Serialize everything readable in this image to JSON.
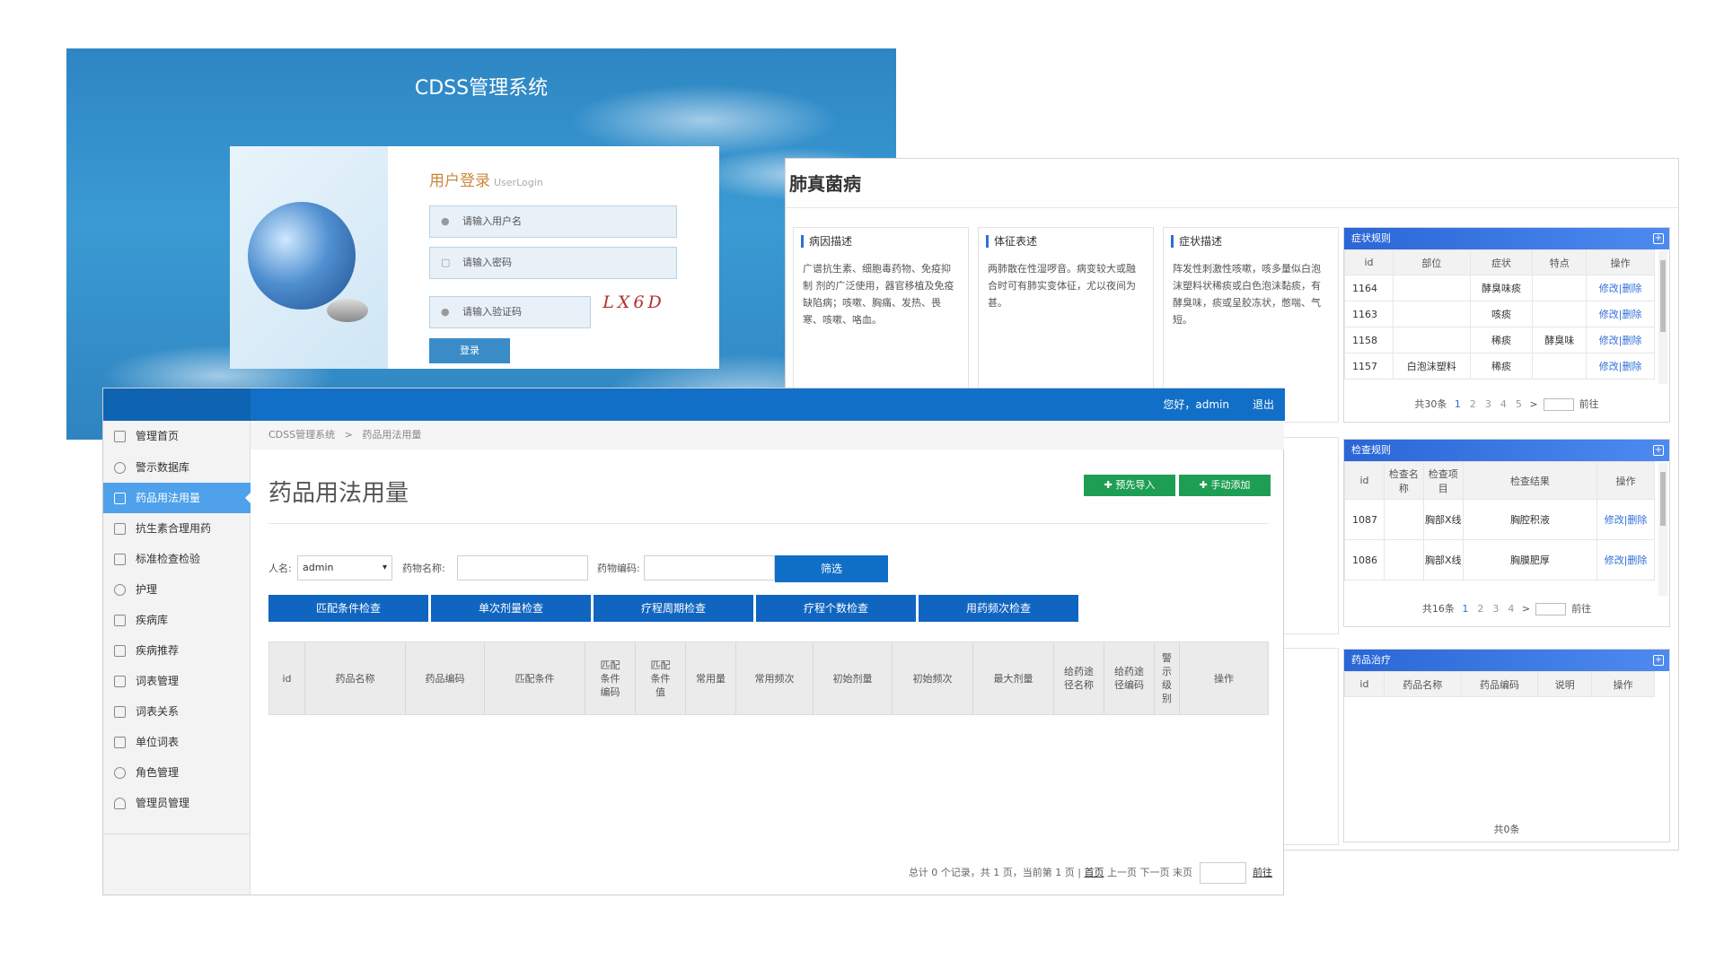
{
  "login": {
    "title": "CDSS管理系统",
    "heading": "用户登录",
    "heading_sub": "UserLogin",
    "username_placeholder": "请输入用户名",
    "password_placeholder": "请输入密码",
    "captcha_placeholder": "请输入验证码",
    "captcha_text": "LX6D",
    "login_button": "登录"
  },
  "detail": {
    "title": "肺真菌病",
    "cards": [
      {
        "label": "病因描述",
        "text": "广谱抗生素、细胞毒药物、免疫抑制 剂的广泛使用，器官移植及免疫缺陷病；咳嗽、胸痛、发热、畏寒、咳嗽、咯血。"
      },
      {
        "label": "体征表述",
        "text": "两肺散在性湿啰音。病变较大或融合时可有肺实变体征，尤以夜间为甚。"
      },
      {
        "label": "症状描述",
        "text": "阵发性刺激性咳嗽，咳多量似白泡沫塑料状稀痰或白色泡沫黏痰，有酵臭味，痰或呈胶冻状，憋喘、气短。"
      }
    ],
    "symptom_panel": {
      "title": "症状规则",
      "columns": [
        "id",
        "部位",
        "症状",
        "特点",
        "操作"
      ],
      "rows": [
        {
          "id": "1164",
          "part": "",
          "symptom": "酵臭味痰",
          "feature": "",
          "op": "修改|删除"
        },
        {
          "id": "1163",
          "part": "",
          "symptom": "咳痰",
          "feature": "",
          "op": "修改|删除"
        },
        {
          "id": "1158",
          "part": "",
          "symptom": "稀痰",
          "feature": "酵臭味",
          "op": "修改|删除"
        },
        {
          "id": "1157",
          "part": "白泡沫塑料",
          "symptom": "稀痰",
          "feature": "",
          "op": "修改|删除"
        }
      ],
      "total": "共30条",
      "pages": [
        "1",
        "2",
        "3",
        "4",
        "5"
      ],
      "next": ">",
      "goto": "前往"
    },
    "exam_panel": {
      "title": "检查规则",
      "columns": [
        "id",
        "检查名称",
        "检查项目",
        "检查结果",
        "操作"
      ],
      "rows": [
        {
          "id": "1087",
          "name": "",
          "item": "胸部X线",
          "result": "胸腔积液",
          "op": "修改|删除"
        },
        {
          "id": "1086",
          "name": "",
          "item": "胸部X线",
          "result": "胸膜肥厚",
          "op": "修改|删除"
        }
      ],
      "total": "共16条",
      "pages": [
        "1",
        "2",
        "3",
        "4"
      ],
      "next": ">",
      "goto": "前往"
    },
    "drug_panel": {
      "title": "药品治疗",
      "columns": [
        "id",
        "药品名称",
        "药品编码",
        "说明",
        "操作"
      ],
      "total": "共0条"
    }
  },
  "admin": {
    "greeting": "您好，admin",
    "logout": "退出",
    "nav": [
      {
        "label": "管理首页",
        "icon": "home-icon"
      },
      {
        "label": "警示数据库",
        "icon": "refresh-icon"
      },
      {
        "label": "药品用法用量",
        "icon": "file-icon"
      },
      {
        "label": "抗生素合理用药",
        "icon": "book-icon"
      },
      {
        "label": "标准检查检验",
        "icon": "edit-icon"
      },
      {
        "label": "护理",
        "icon": "share-icon"
      },
      {
        "label": "疾病库",
        "icon": "bookmark-icon"
      },
      {
        "label": "疾病推荐",
        "icon": "bookmark-icon"
      },
      {
        "label": "词表管理",
        "icon": "list-icon"
      },
      {
        "label": "词表关系",
        "icon": "list-icon"
      },
      {
        "label": "单位词表",
        "icon": "grid-icon"
      },
      {
        "label": "角色管理",
        "icon": "gear-icon"
      },
      {
        "label": "管理员管理",
        "icon": "user-icon"
      }
    ],
    "breadcrumb": {
      "root": "CDSS管理系统",
      "sep": ">",
      "current": "药品用法用量"
    },
    "page_title": "药品用法用量",
    "import_button": "✚ 预先导入",
    "add_button": "✚ 手动添加",
    "filters": {
      "person_label": "人名:",
      "person_value": "admin",
      "drug_name_label": "药物名称:",
      "drug_code_label": "药物编码:",
      "filter_button": "筛选"
    },
    "check_buttons": [
      "匹配条件检查",
      "单次剂量检查",
      "疗程周期检查",
      "疗程个数检查",
      "用药频次检查"
    ],
    "columns": [
      "id",
      "药品名称",
      "药品编码",
      "匹配条件",
      "匹配条件编码",
      "匹配条件值",
      "常用量",
      "常用频次",
      "初始剂量",
      "初始频次",
      "最大剂量",
      "给药途径名称",
      "给药途径编码",
      "警示级别",
      "操作"
    ],
    "pager": {
      "summary": "总计 0 个记录，共 1 页，当前第 1 页 |",
      "first": "首页",
      "prev": "上一页",
      "next": "下一页",
      "last": "末页",
      "goto": "前往"
    }
  },
  "colors": {
    "primary_blue": "#126fc7",
    "green": "#1e9e54",
    "panel_blue": "#2a66d6",
    "active_nav": "#4ea1ea"
  }
}
